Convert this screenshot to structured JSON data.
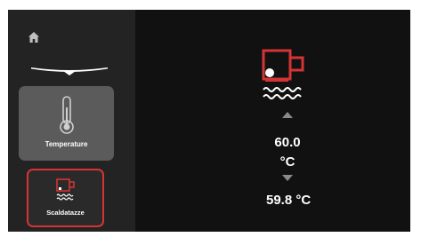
{
  "sidebar": {
    "tiles": [
      {
        "label": "Temperature",
        "icon": "thermometer-icon",
        "selected": false
      },
      {
        "label": "Scaldatazze",
        "icon": "cup-warmer-icon",
        "selected": true
      }
    ]
  },
  "main": {
    "icon": "cup-warmer-icon",
    "setpoint_value": "60.0",
    "setpoint_unit": "°C",
    "current_temperature": "59.8 °C"
  },
  "colors": {
    "accent": "#d43434",
    "background": "#111111",
    "sidebar": "#232323",
    "tile_selected_bg": "#5b5b5b",
    "arrow": "#8a8a8a"
  }
}
